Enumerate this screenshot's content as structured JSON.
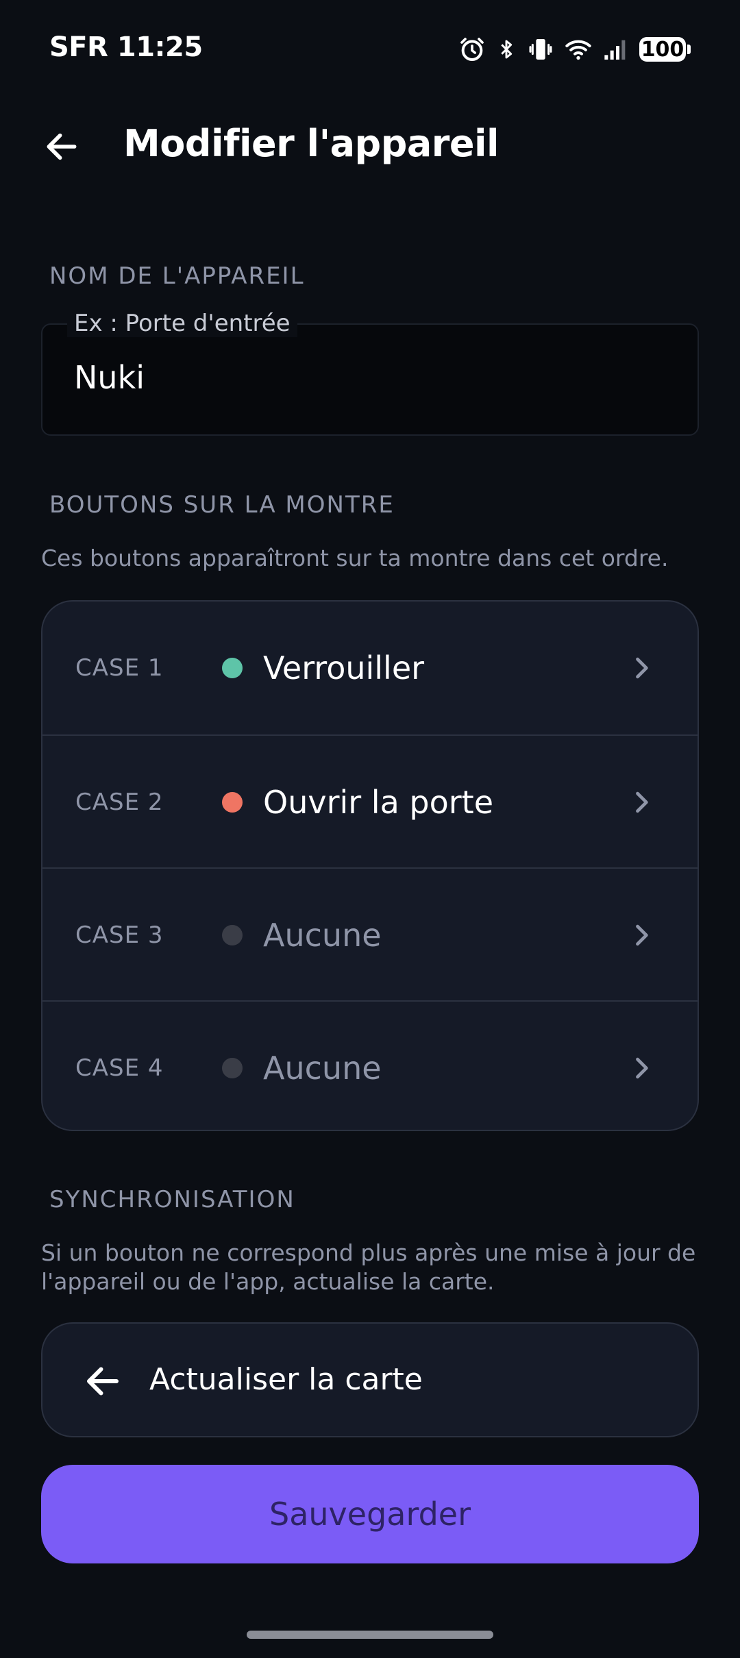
{
  "status_bar": {
    "carrier_time": "SFR 11:25",
    "battery": "100",
    "icons": [
      "alarm-icon",
      "bluetooth-icon",
      "vibrate-icon",
      "wifi-icon",
      "signal-icon",
      "battery-icon"
    ]
  },
  "header": {
    "title": "Modifier l'appareil",
    "back_icon": "arrow-left-icon"
  },
  "device_name": {
    "section_label": "NOM DE L'APPAREIL",
    "placeholder": "Ex : Porte d'entrée",
    "value": "Nuki"
  },
  "watch_buttons": {
    "section_label": "BOUTONS SUR LA MONTRE",
    "helper": "Ces boutons apparaîtront sur ta montre dans cet ordre.",
    "slots": [
      {
        "case": "CASE 1",
        "action": "Verrouiller",
        "dot_color": "#5ec4a8",
        "active": true
      },
      {
        "case": "CASE 2",
        "action": "Ouvrir la porte",
        "dot_color": "#ef7563",
        "active": true
      },
      {
        "case": "CASE 3",
        "action": "Aucune",
        "dot_color": "#3a3d47",
        "active": false
      },
      {
        "case": "CASE 4",
        "action": "Aucune",
        "dot_color": "#3a3d47",
        "active": false
      }
    ]
  },
  "sync": {
    "section_label": "SYNCHRONISATION",
    "helper": "Si un bouton ne correspond plus après une mise à jour de l'appareil ou de l'app, actualise la carte.",
    "refresh_label": "Actualiser la carte"
  },
  "save_label": "Sauvegarder",
  "colors": {
    "background": "#0b0e14",
    "card": "#151a27",
    "accent": "#7b5cf6",
    "muted_text": "#8f95a8"
  }
}
